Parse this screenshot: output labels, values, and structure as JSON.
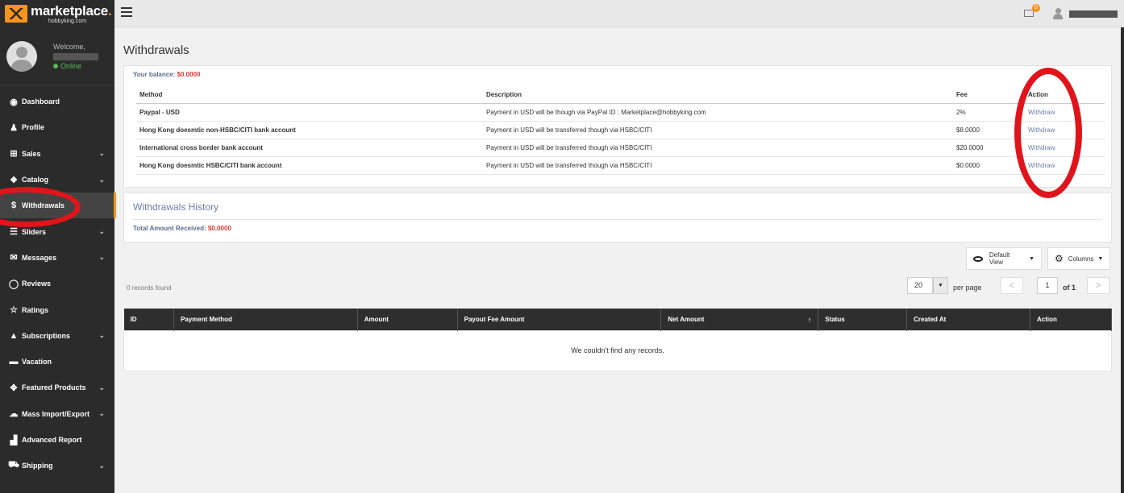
{
  "app": {
    "brand": "marketplace",
    "brand_dot": ".",
    "brand_sub": "hobbyking.com"
  },
  "user": {
    "welcome": "Welcome,",
    "status": "Online"
  },
  "topbar": {
    "notification_count": "0"
  },
  "sidebar": {
    "items": [
      {
        "label": "Dashboard",
        "icon": "dashboard-icon",
        "glyph": "◉",
        "chevron": false
      },
      {
        "label": "Profile",
        "icon": "profile-icon",
        "glyph": "♟",
        "chevron": false
      },
      {
        "label": "Sales",
        "icon": "cart-icon",
        "glyph": "⊞",
        "chevron": true
      },
      {
        "label": "Catalog",
        "icon": "catalog-icon",
        "glyph": "❖",
        "chevron": true
      },
      {
        "label": "Withdrawals",
        "icon": "dollar-icon",
        "glyph": "$",
        "chevron": false,
        "active": true
      },
      {
        "label": "Sliders",
        "icon": "sliders-icon",
        "glyph": "☰",
        "chevron": true
      },
      {
        "label": "Messages",
        "icon": "envelope-icon",
        "glyph": "✉",
        "chevron": true
      },
      {
        "label": "Reviews",
        "icon": "comment-icon",
        "glyph": "◯",
        "chevron": false
      },
      {
        "label": "Ratings",
        "icon": "star-icon",
        "glyph": "☆",
        "chevron": false
      },
      {
        "label": "Subscriptions",
        "icon": "thumbs-up-icon",
        "glyph": "▲",
        "chevron": true
      },
      {
        "label": "Vacation",
        "icon": "bed-icon",
        "glyph": "▬",
        "chevron": false
      },
      {
        "label": "Featured Products",
        "icon": "featured-icon",
        "glyph": "✥",
        "chevron": true
      },
      {
        "label": "Mass Import/Export",
        "icon": "cloud-icon",
        "glyph": "☁",
        "chevron": true
      },
      {
        "label": "Advanced Report",
        "icon": "chart-icon",
        "glyph": "▟",
        "chevron": false
      },
      {
        "label": "Shipping",
        "icon": "truck-icon",
        "glyph": "⛟",
        "chevron": true
      }
    ]
  },
  "page": {
    "title": "Withdrawals",
    "balance_label": "Your balance:",
    "balance_amount": "$0.0000"
  },
  "methods_table": {
    "headers": {
      "method": "Method",
      "description": "Description",
      "fee": "Fee",
      "action": "Action"
    },
    "rows": [
      {
        "method": "Paypal - USD",
        "description": "Payment in USD will be though via PayPal ID : Marketplace@hobbyking.com",
        "fee": "2%",
        "action": "Withdraw"
      },
      {
        "method": "Hong Kong doesmtic non-HSBC/CITI bank account",
        "description": "Payment in USD will be transferred though via HSBC/CITI",
        "fee": "$8.0000",
        "action": "Withdraw"
      },
      {
        "method": "International cross border bank account",
        "description": "Payment in USD will be transferred though via HSBC/CITI",
        "fee": "$20.0000",
        "action": "Withdraw"
      },
      {
        "method": "Hong Kong doesmtic HSBC/CITI bank account",
        "description": "Payment in USD will be transferred though via HSBC/CITI",
        "fee": "$0.0000",
        "action": "Withdraw"
      }
    ]
  },
  "history": {
    "title": "Withdrawals History",
    "total_label": "Total Amount Received:",
    "total_amount": "$0.0000",
    "default_view": "Default View",
    "columns": "Columns",
    "records_found": "0 records found",
    "per_page_value": "20",
    "per_page_label": "per page",
    "prev": "<",
    "page_value": "1",
    "of_label": "of 1",
    "next": ">",
    "headers": [
      "ID",
      "Payment Method",
      "Amount",
      "Payout Fee Amount",
      "Net Amount",
      "Status",
      "Created At",
      "Action"
    ],
    "sort_indicator": "↑",
    "empty_message": "We couldn't find any records."
  }
}
